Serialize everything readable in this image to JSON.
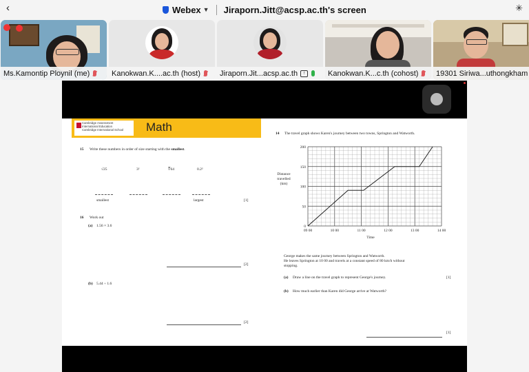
{
  "topbar": {
    "app_name": "Webex",
    "screen_title": "Jiraporn.Jitt@acsp.ac.th's screen"
  },
  "participants": [
    {
      "label": "Ms.Kamontip Ploynil (me)"
    },
    {
      "label": "Kanokwan.K....ac.th (host)"
    },
    {
      "label": "Jiraporn.Jit...acsp.ac.th"
    },
    {
      "label": "Kanokwan.K...c.th (cohost)"
    },
    {
      "label": "19301 Siriwa...uthongkham"
    }
  ],
  "slide": {
    "header": {
      "logo_line1": "Cambridge Assessment",
      "logo_line2": "International Education",
      "logo_line3": "Cambridge International School",
      "subject": "Math"
    },
    "q15": {
      "number": "15",
      "text_pre": "Write these numbers in order of size starting with the",
      "text_bold": "smallest",
      "items": [
        "√25",
        "3²",
        "∛64",
        "0.2²"
      ],
      "left_label": "smallest",
      "right_label": "largest",
      "marks": "[1]"
    },
    "q16": {
      "number": "16",
      "text": "Work out",
      "part_a_label": "(a)",
      "part_a_text": "1.56 × 3.6",
      "part_a_marks": "[2]",
      "part_b_label": "(b)",
      "part_b_text": "5.44 ÷ 1.6",
      "part_b_marks": "[2]"
    },
    "q14": {
      "number": "14",
      "intro": "The travel graph shows Karen's journey between two towns, Springton and Watworth.",
      "para_line1": "George makes the same journey between Springton and Watworth.",
      "para_line2": "He leaves Springton at 10 00 and travels at a constant speed of 80 km/h without",
      "para_line3": "stopping.",
      "part_a_label": "(a)",
      "part_a_text": "Draw a line on the travel graph to represent George's journey.",
      "part_a_marks": "[1]",
      "part_b_label": "(b)",
      "part_b_text": "How much earlier than Karen did George arrive at Watworth?",
      "part_b_marks": "[1]"
    }
  },
  "chart_data": {
    "type": "line",
    "xlabel": "Time",
    "ylabel": "Distance travelled (km)",
    "ylabel_lines": [
      "Distance",
      "travelled",
      "(km)"
    ],
    "x_ticks": [
      "09 00",
      "10 00",
      "11 00",
      "12 00",
      "13 00",
      "14 00"
    ],
    "y_ticks": [
      0,
      50,
      100,
      150,
      200
    ],
    "xlim_hours": [
      9,
      14
    ],
    "ylim": [
      0,
      200
    ],
    "series": [
      {
        "x": [
          "09 00",
          "10 30",
          "11 05",
          "12 15",
          "13 10",
          "13 40"
        ],
        "y": [
          0,
          90,
          90,
          150,
          150,
          200
        ]
      }
    ],
    "grid": true
  }
}
